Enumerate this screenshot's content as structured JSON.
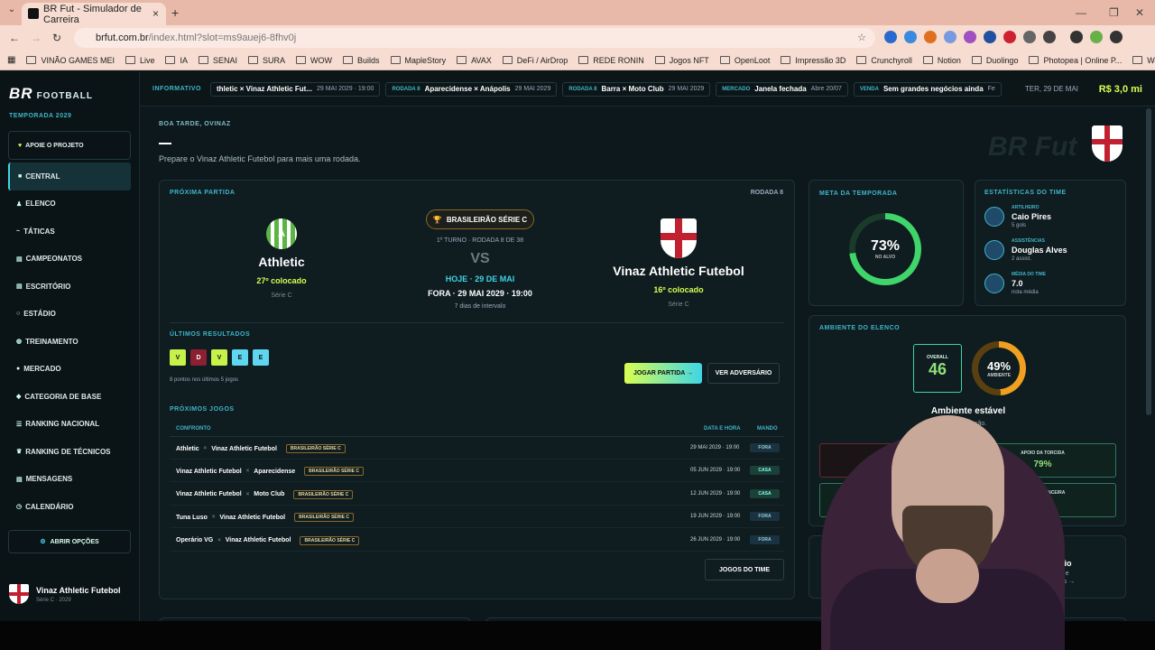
{
  "browser": {
    "tab_title": "BR Fut - Simulador de Carreira",
    "url_host": "brfut.com.br",
    "url_path": "/index.html?slot=ms9auej6-8fhv0j",
    "bookmarks": [
      "VINÃO GAMES MEI",
      "Live",
      "IA",
      "SENAI",
      "SURA",
      "WOW",
      "Builds",
      "MapleStory",
      "AVAX",
      "DeFi / AirDrop",
      "REDE RONIN",
      "Jogos NFT",
      "OpenLoot",
      "Impressão 3D",
      "Crunchyroll",
      "Notion",
      "Duolingo",
      "Photopea | Online P...",
      "WebTV Player"
    ]
  },
  "sidebar": {
    "logo": "BR",
    "logo_sub": "FOOTBALL",
    "season": "TEMPORADA 2029",
    "support": "APOIE O PROJETO",
    "items": [
      "CENTRAL",
      "ELENCO",
      "TÁTICAS",
      "CAMPEONATOS",
      "ESCRITÓRIO",
      "ESTÁDIO",
      "TREINAMENTO",
      "MERCADO",
      "CATEGORIA DE BASE",
      "RANKING NACIONAL",
      "RANKING DE TÉCNICOS",
      "MENSAGENS",
      "CALENDÁRIO"
    ],
    "options": "ABRIR OPÇÕES",
    "club_name": "Vinaz Athletic Futebol",
    "club_sub": "Série C · 2029"
  },
  "ticker": {
    "label": "INFORMATIVO",
    "items": [
      {
        "k": "",
        "v": "thletic × Vinaz Athletic Fut...",
        "d": "29 MAI 2029 · 19:00"
      },
      {
        "k": "RODADA 8",
        "v": "Aparecidense × Anápolis",
        "d": "29 MAI 2029"
      },
      {
        "k": "RODADA 8",
        "v": "Barra × Moto Club",
        "d": "29 MAI 2029"
      },
      {
        "k": "MERCADO",
        "v": "Janela fechada",
        "d": "Abre 20/07"
      },
      {
        "k": "VENDA",
        "v": "Sem grandes negócios ainda",
        "d": "Fe"
      }
    ],
    "date": "TER, 29 DE MAI",
    "money": "R$ 3,0 mi"
  },
  "header": {
    "greeting": "BOA TARDE, OVINAZ",
    "subtitle": "Prepare o Vinaz Athletic Futebol para mais uma rodada.",
    "watermark": "BR Fut"
  },
  "match": {
    "title": "PRÓXIMA PARTIDA",
    "round": "RODADA 8",
    "competition": "BRASILEIRÃO SÉRIE C",
    "turno": "1º TURNO · RODADA 8 DE 38",
    "vs": "VS",
    "when": "HOJE · 29 DE MAI",
    "where": "FORA · 29 MAI 2029 · 19:00",
    "interval": "7 dias de intervalo",
    "home": {
      "name": "Athletic",
      "pos": "27º colocado",
      "div": "Série C",
      "crest": "A"
    },
    "away": {
      "name": "Vinaz Athletic Futebol",
      "pos": "16º colocado",
      "div": "Série C"
    },
    "last_title": "ÚLTIMOS RESULTADOS",
    "form": [
      "V",
      "D",
      "V",
      "E",
      "E"
    ],
    "points": "8 pontos nos últimos 5 jogos",
    "play": "JOGAR PARTIDA →",
    "view": "VER ADVERSÁRIO",
    "next_title": "PRÓXIMOS JOGOS",
    "col_match": "CONFRONTO",
    "col_date": "DATA E HORA",
    "col_mando": "MANDO",
    "fixtures": [
      {
        "a": "Athletic",
        "b": "Vinaz Athletic Futebol",
        "c": "BRASILEIRÃO SÉRIE C",
        "d": "29 MAI 2029 · 19:00",
        "m": "FORA"
      },
      {
        "a": "Vinaz Athletic Futebol",
        "b": "Aparecidense",
        "c": "BRASILEIRÃO SÉRIE C",
        "d": "05 JUN 2029 · 19:00",
        "m": "CASA"
      },
      {
        "a": "Vinaz Athletic Futebol",
        "b": "Moto Club",
        "c": "BRASILEIRÃO SÉRIE C",
        "d": "12 JUN 2029 · 19:00",
        "m": "CASA"
      },
      {
        "a": "Tuna Luso",
        "b": "Vinaz Athletic Futebol",
        "c": "BRASILEIRÃO SÉRIE C",
        "d": "19 JUN 2029 · 19:00",
        "m": "FORA"
      },
      {
        "a": "Operário VG",
        "b": "Vinaz Athletic Futebol",
        "c": "BRASILEIRÃO SÉRIE C",
        "d": "26 JUN 2029 · 19:00",
        "m": "FORA"
      }
    ],
    "all_games": "JOGOS DO TIME"
  },
  "meta": {
    "title": "META DA TEMPORADA",
    "pct": "73%",
    "label": "NO ALVO",
    "value": 0.73
  },
  "stats": {
    "title": "ESTATÍSTICAS DO TIME",
    "items": [
      {
        "k": "ARTILHEIRO",
        "v": "Caio Pires",
        "s": "5 gols"
      },
      {
        "k": "ASSISTÊNCIAS",
        "v": "Douglas Alves",
        "s": "2 assist."
      },
      {
        "k": "MÉDIA DO TIME",
        "v": "7.0",
        "s": "nota média"
      }
    ]
  },
  "ambiente": {
    "title": "AMBIENTE DO ELENCO",
    "overall_k": "OVERALL",
    "overall": "46",
    "pct": "49%",
    "label": "AMBIENTE",
    "value": 0.49,
    "status": "Ambiente estável",
    "status_sub": "ndo pressão.",
    "boxes": [
      {
        "k": "ORÇAMENTO",
        "v": "R$"
      },
      {
        "k": "APOIO DA TORCIDA",
        "v": "79%"
      },
      {
        "k": "",
        "v": ""
      },
      {
        "k": "SAÚDE FINANCEIRA",
        "v": "77%"
      }
    ]
  },
  "escritorio": {
    "t1": "itório",
    "t2": "ento e",
    "t3": "entos →"
  },
  "colors": {
    "accent": "#3fd5e6",
    "lime": "#d8ff50",
    "win": "#c6f24a",
    "loss": "#8a2030",
    "draw": "#5fd6f0"
  }
}
